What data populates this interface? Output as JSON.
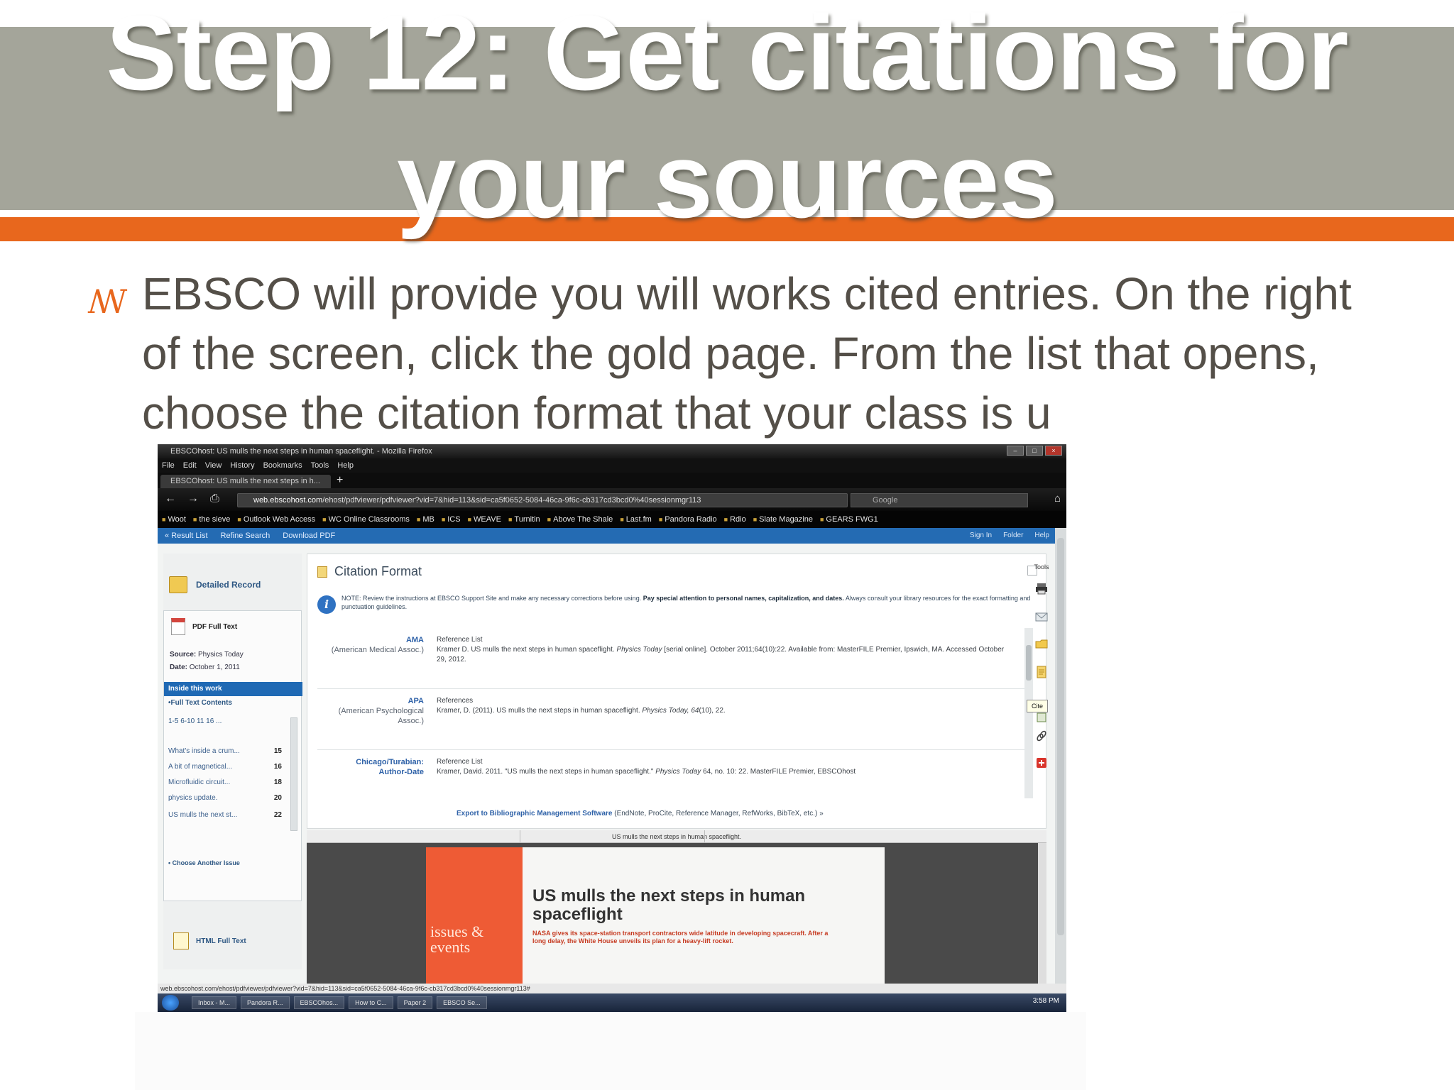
{
  "slide": {
    "title_line1": "Step 12: Get citations for",
    "title_line2": "your sources",
    "bullet_glyph": "ꟿ",
    "body": "EBSCO will provide you will works cited entries. On the right of the screen, click the gold page. From the list that opens, choose the citation format that your class is u"
  },
  "colors": {
    "title_band": "#a4a59a",
    "accent": "#e8671d",
    "body_text": "#544f48"
  },
  "screenshot": {
    "window_title": "EBSCOhost: US mulls the next steps in human spaceflight. - Mozilla Firefox",
    "menu": [
      "File",
      "Edit",
      "View",
      "History",
      "Bookmarks",
      "Tools",
      "Help"
    ],
    "tab_label": "EBSCOhost: US mulls the next steps in h...",
    "url_domain": "web.ebscohost.com",
    "url_rest": "/ehost/pdfviewer/pdfviewer?vid=7&hid=113&sid=ca5f0652-5084-46ca-9f6c-cb317cd3bcd0%40sessionmgr113",
    "search_placeholder": "Google",
    "bookmarks": [
      "Woot",
      "the sieve",
      "Outlook Web Access",
      "WC Online Classrooms",
      "MB",
      "ICS",
      "WEAVE",
      "Turnitin",
      "Above The Shale",
      "Last.fm",
      "Pandora Radio",
      "Rdio",
      "Slate Magazine",
      "GEARS FWG1"
    ],
    "toolbar": {
      "result_list": "« Result List",
      "refine_search": "Refine Search",
      "download_pdf": "Download PDF",
      "sign_in": "Sign In",
      "folder": "Folder",
      "help": "Help"
    },
    "left_panel": {
      "detailed_record": "Detailed Record",
      "pdf_full_text": "PDF Full Text",
      "source_label": "Source:",
      "source_value": "Physics Today",
      "date_label": "Date:",
      "date_value": "October 1, 2011",
      "inside_this_work": "Inside this work",
      "full_text_contents": "•Full Text Contents",
      "pager": "1-5  6-10  11  16  ...",
      "items": [
        {
          "title": "What's inside a crum...",
          "page": "15"
        },
        {
          "title": "A bit of magnetical...",
          "page": "16"
        },
        {
          "title": "Microfluidic circuit...",
          "page": "18"
        },
        {
          "title": "physics update.",
          "page": "20"
        },
        {
          "title": "US mulls the next st...",
          "page": "22"
        }
      ],
      "choose_another_issue": "• Choose Another Issue",
      "html_full_text": "HTML Full Text"
    },
    "citation": {
      "title": "Citation Format",
      "note_prefix": "NOTE: Review the instructions at EBSCO Support Site and make any necessary corrections before using.",
      "note_bold": "Pay special attention to personal names, capitalization, and dates.",
      "note_suffix": "Always consult your library resources for the exact formatting and punctuation guidelines.",
      "entries": [
        {
          "style": "AMA",
          "style_full": "(American Medical Assoc.)",
          "heading": "Reference List",
          "text": "Kramer D. US mulls the next steps in human spaceflight.",
          "journal": "Physics Today",
          "rest": "[serial online]. October 2011;64(10):22. Available from: MasterFILE Premier, Ipswich, MA. Accessed October 29, 2012."
        },
        {
          "style": "APA",
          "style_full": "(American Psychological Assoc.)",
          "heading": "References",
          "text": "Kramer, D. (2011). US mulls the next steps in human spaceflight.",
          "journal": "Physics Today, 64",
          "rest": "(10), 22."
        },
        {
          "style": "Chicago/Turabian:",
          "style_full": "Author-Date",
          "heading": "Reference List",
          "text": "Kramer, David. 2011. \"US mulls the next steps in human spaceflight.\"",
          "journal": "Physics Today",
          "rest": "64, no. 10: 22. MasterFILE Premier, EBSCOhost"
        }
      ],
      "export_label": "Export to Bibliographic Management Software",
      "export_rest": "(EndNote, ProCite, Reference Manager, RefWorks, BibTeX, etc.) »"
    },
    "tools_label": "Tools",
    "cite_tooltip": "Cite",
    "pdf": {
      "bar_title": "US mulls the next steps in human spaceflight.",
      "section": "issues & events",
      "headline": "US mulls the next steps in human spaceflight",
      "subhead": "NASA gives its space-station transport contractors wide latitude in developing spacecraft. After a long delay, the White House unveils its plan for a heavy-lift rocket."
    },
    "status_url": "web.ebscohost.com/ehost/pdfviewer/pdfviewer?vid=7&hid=113&sid=ca5f0652-5084-46ca-9f6c-cb317cd3bcd0%40sessionmgr113#",
    "taskbar": [
      "Inbox - M...",
      "Pandora R...",
      "EBSCOhos...",
      "How to C...",
      "Paper 2",
      "EBSCO Se..."
    ],
    "clock": "3:58 PM"
  }
}
